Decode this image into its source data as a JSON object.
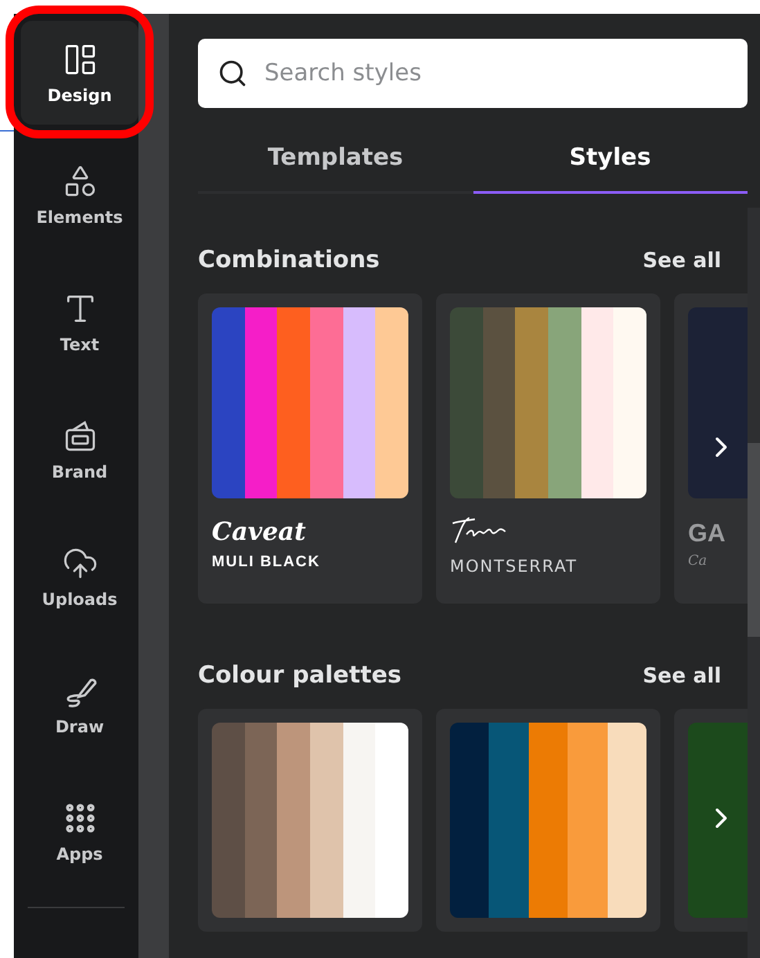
{
  "sidebar": {
    "items": [
      {
        "label": "Design",
        "kind": "design",
        "selected": true
      },
      {
        "label": "Elements",
        "kind": "elements",
        "selected": false
      },
      {
        "label": "Text",
        "kind": "text",
        "selected": false
      },
      {
        "label": "Brand",
        "kind": "brand",
        "selected": false
      },
      {
        "label": "Uploads",
        "kind": "uploads",
        "selected": false
      },
      {
        "label": "Draw",
        "kind": "draw",
        "selected": false
      },
      {
        "label": "Apps",
        "kind": "apps",
        "selected": false
      }
    ]
  },
  "search": {
    "placeholder": "Search styles"
  },
  "tabs": [
    {
      "label": "Templates",
      "selected": false
    },
    {
      "label": "Styles",
      "selected": true
    }
  ],
  "sections": [
    {
      "title": "Combinations",
      "see_all": "See all",
      "kind": "combinations",
      "cards": [
        {
          "swatches": [
            {
              "color": "#2b44c1"
            },
            {
              "color": "#f51ec8"
            },
            {
              "color": "#fe5f1f"
            },
            {
              "color": "#fd6d95"
            },
            {
              "color": "#d7bcfd"
            },
            {
              "color": "#fec995"
            }
          ],
          "headline": {
            "text": "Caveat",
            "kind": "script"
          },
          "subtitle": {
            "text": "MULI BLACK",
            "kind": "heavy"
          }
        },
        {
          "swatches": [
            {
              "color": "#3c4a39"
            },
            {
              "color": "#5b5140"
            },
            {
              "color": "#a9853f"
            },
            {
              "color": "#88a57a"
            },
            {
              "color": "#ffe9e9"
            },
            {
              "color": "#fff9f1"
            }
          ],
          "headline": {
            "kind": "signature"
          },
          "subtitle": {
            "text": "MONTSERRAT",
            "kind": "light"
          }
        },
        {
          "swatches": [
            {
              "color": "#1c2236"
            }
          ],
          "headline": {
            "text": "GA",
            "kind": "heavy"
          },
          "subtitle": {
            "text": "Ca",
            "kind": "script"
          }
        }
      ]
    },
    {
      "title": "Colour palettes",
      "see_all": "See all",
      "kind": "palettes",
      "cards": [
        {
          "swatches": [
            {
              "color": "#5e4f46"
            },
            {
              "color": "#7c6556"
            },
            {
              "color": "#bd957b"
            },
            {
              "color": "#dfc3ab"
            },
            {
              "color": "#f7f5f2"
            },
            {
              "color": "#ffffff"
            }
          ]
        },
        {
          "swatches": [
            {
              "color": "#02203f"
            },
            {
              "color": "#075677"
            },
            {
              "color": "#ec7b04"
            },
            {
              "color": "#f99b3c"
            },
            {
              "color": "#f8dcbb"
            }
          ]
        },
        {
          "swatches": [
            {
              "color": "#1c4a1c"
            }
          ]
        }
      ]
    }
  ]
}
